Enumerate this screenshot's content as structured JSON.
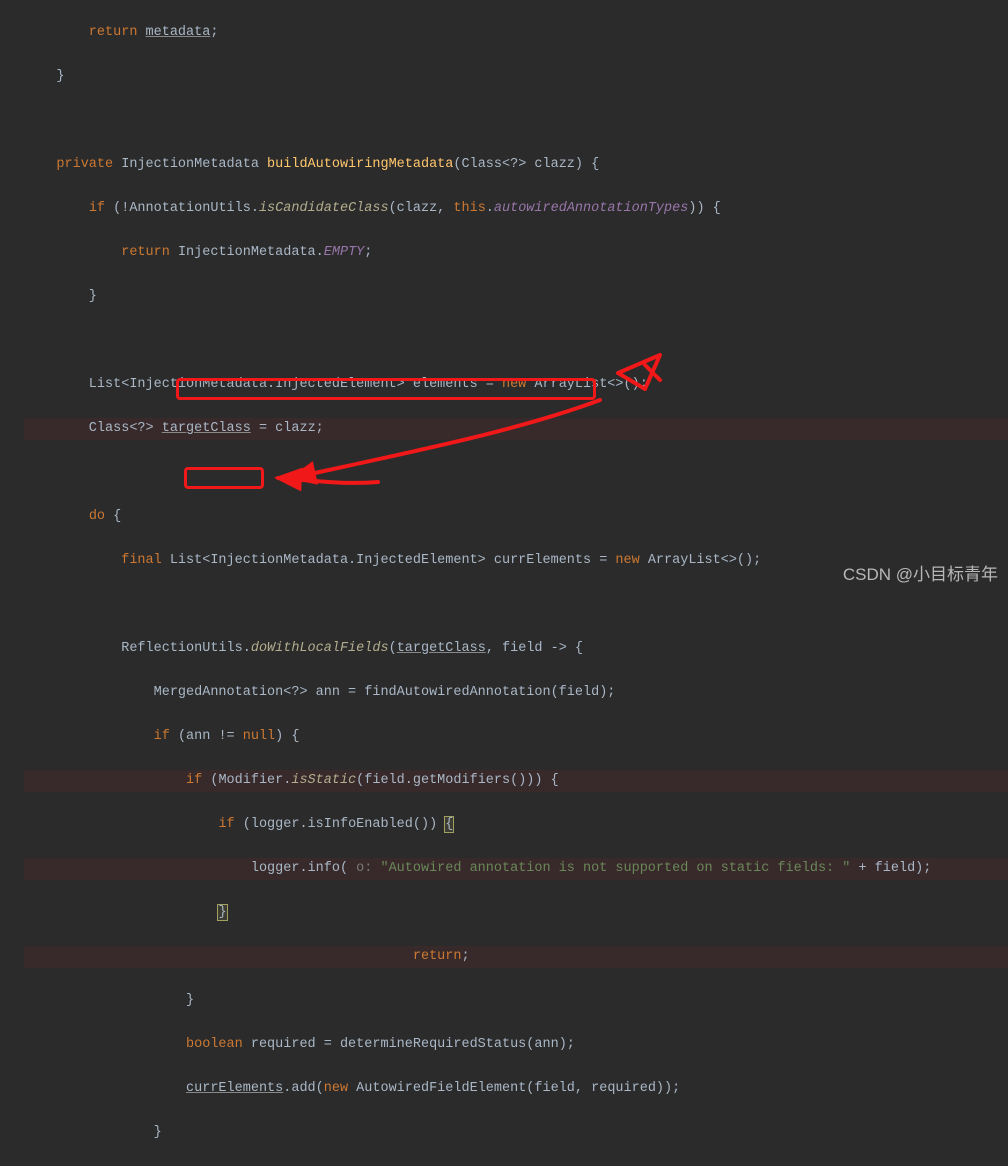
{
  "code": {
    "l0": "        return metadata;",
    "l1": "    }",
    "l2": "",
    "l3_pre": "    private ",
    "l3_type": "InjectionMetadata ",
    "l3_method": "buildAutowiringMetadata",
    "l3_post": "(Class<?> clazz) {",
    "l4_pre": "        if (!AnnotationUtils.",
    "l4_m": "isCandidateClass",
    "l4_mid": "(clazz, ",
    "l4_this": "this",
    "l4_dot": ".",
    "l4_field": "autowiredAnnotationTypes",
    "l4_post": ")) {",
    "l5_pre": "            return ",
    "l5_cls": "InjectionMetadata.",
    "l5_empty": "EMPTY",
    "l5_post": ";",
    "l6": "        }",
    "l7": "",
    "l8_pre": "        List<InjectionMetadata.InjectedElement> elements = ",
    "l8_new": "new ",
    "l8_cls": "ArrayList<>();",
    "l9_pre": "        Class<?> ",
    "l9_var": "targetClass",
    "l9_post": " = clazz;",
    "l10": "",
    "l11_pre": "        do ",
    "l11_post": "{",
    "l12_pre": "            final ",
    "l12_mid": "List<InjectionMetadata.InjectedElement> currElements = ",
    "l12_new": "new ",
    "l12_cls": "ArrayList<>();",
    "l13": "",
    "l14_pre": "            ReflectionUtils.",
    "l14_m": "doWithLocalFields",
    "l14_open": "(",
    "l14_arg": "targetClass",
    "l14_post": ", field -> {",
    "l15_pre": "                MergedAnnotation<?> ann = findAutowiredAnnotation(field);",
    "l16_pre": "                if ",
    "l16_cond": "(ann != ",
    "l16_null": "null",
    "l16_post": ") {",
    "l17_pre": "                    if ",
    "l17_mid1": "(Modifier.",
    "l17_m": "isStatic",
    "l17_post": "(field.getModifiers())) {",
    "l18_pre": "                        if ",
    "l18_cond": "(logger.isInfoEnabled()) ",
    "l18_brace": "{",
    "l19_pre": "                            logger.info(",
    "l19_hint": " o: ",
    "l19_str": "\"Autowired annotation is not supported on static fields: \"",
    "l19_post": " + field);",
    "l20_brace": "                        }",
    "l21_pre": "                        return",
    "l21_post": ";",
    "l22": "                    }",
    "l23_pre": "                    boolean ",
    "l23_mid": "required = determineRequiredStatus(ann);",
    "l24_pre": "                    ",
    "l24_var": "currElements",
    "l24_mid": ".add(",
    "l24_new": "new ",
    "l24_cls": "AutowiredFieldElement(field, required));",
    "l25": "                }"
  },
  "watermark": "CSDN @小目标青年"
}
